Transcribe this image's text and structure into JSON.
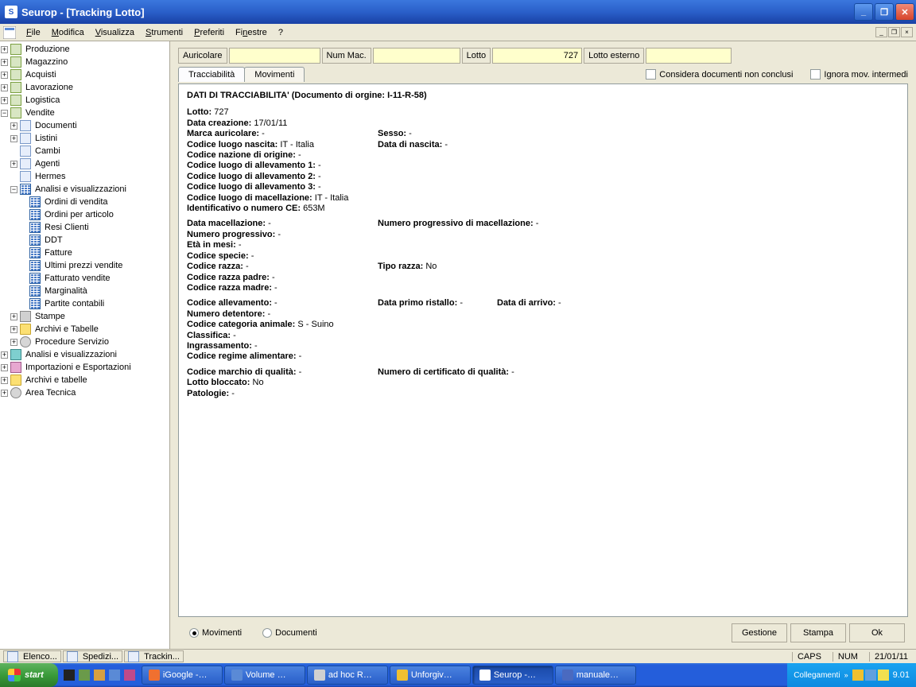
{
  "window": {
    "title": "Seurop - [Tracking Lotto]"
  },
  "menu": {
    "file": "File",
    "modifica": "Modifica",
    "visualizza": "Visualizza",
    "strumenti": "Strumenti",
    "preferiti": "Preferiti",
    "finestre": "Finestre",
    "help": "?"
  },
  "tree": {
    "produzione": "Produzione",
    "magazzino": "Magazzino",
    "acquisti": "Acquisti",
    "lavorazione": "Lavorazione",
    "logistica": "Logistica",
    "vendite": "Vendite",
    "documenti": "Documenti",
    "listini": "Listini",
    "cambi": "Cambi",
    "agenti": "Agenti",
    "hermes": "Hermes",
    "analisi": "Analisi e visualizzazioni",
    "ordini_vendita": "Ordini di vendita",
    "ordini_articolo": "Ordini per articolo",
    "resi": "Resi Clienti",
    "ddt": "DDT",
    "fatture": "Fatture",
    "ultimi_prezzi": "Ultimi prezzi vendite",
    "fatturato": "Fatturato vendite",
    "marginalita": "Marginalità",
    "partite": "Partite contabili",
    "stampe": "Stampe",
    "archivi_tab": "Archivi e Tabelle",
    "procedure": "Procedure Servizio",
    "analisi2": "Analisi e visualizzazioni",
    "import_export": "Importazioni e Esportazioni",
    "archivi_tab2": "Archivi e tabelle",
    "area_tecnica": "Area Tecnica"
  },
  "filters": {
    "auricolare_label": "Auricolare",
    "auricolare_val": "",
    "nummac_label": "Num Mac.",
    "nummac_val": "",
    "lotto_label": "Lotto",
    "lotto_val": "727",
    "lottoest_label": "Lotto esterno",
    "lottoest_val": ""
  },
  "tabs": {
    "tracciabilita": "Tracciabilità",
    "movimenti": "Movimenti"
  },
  "options": {
    "considera": "Considera documenti non conclusi",
    "ignora": "Ignora mov. intermedi"
  },
  "doc": {
    "header": "DATI DI TRACCIABILITA' (Documento di orgine: I-11-R-58)",
    "lotto_l": "Lotto:",
    "lotto_v": "727",
    "data_creaz_l": "Data creazione:",
    "data_creaz_v": "17/01/11",
    "marca_l": "Marca auricolare:",
    "marca_v": "-",
    "sesso_l": "Sesso:",
    "sesso_v": "-",
    "luogo_nasc_l": "Codice luogo nascita:",
    "luogo_nasc_v": "IT - Italia",
    "data_nasc_l": "Data di nascita:",
    "data_nasc_v": "-",
    "naz_orig_l": "Codice nazione di origine:",
    "naz_orig_v": "-",
    "allev1_l": "Codice luogo di allevamento 1:",
    "allev1_v": "-",
    "allev2_l": "Codice luogo di allevamento 2:",
    "allev2_v": "-",
    "allev3_l": "Codice luogo di allevamento 3:",
    "allev3_v": "-",
    "macell_l": "Codice luogo di macellazione:",
    "macell_v": "IT - Italia",
    "ident_l": "Identificativo o numero CE:",
    "ident_v": "653M",
    "data_mac_l": "Data macellazione:",
    "data_mac_v": "-",
    "num_prog_mac_l": "Numero progressivo di macellazione:",
    "num_prog_mac_v": "-",
    "num_prog_l": "Numero progressivo:",
    "num_prog_v": "-",
    "eta_l": "Età in mesi:",
    "eta_v": "-",
    "specie_l": "Codice specie:",
    "specie_v": "-",
    "razza_l": "Codice razza:",
    "razza_v": "-",
    "tipo_razza_l": "Tipo razza:",
    "tipo_razza_v": "No",
    "razza_padre_l": "Codice razza padre:",
    "razza_padre_v": "-",
    "razza_madre_l": "Codice razza madre:",
    "razza_madre_v": "-",
    "cod_allev_l": "Codice allevamento:",
    "cod_allev_v": "-",
    "primo_rist_l": "Data primo ristallo:",
    "primo_rist_v": "-",
    "data_arrivo_l": "Data di arrivo:",
    "data_arrivo_v": "-",
    "num_det_l": "Numero detentore:",
    "num_det_v": "-",
    "cat_anim_l": "Codice categoria animale:",
    "cat_anim_v": "S - Suino",
    "classifica_l": "Classifica:",
    "classifica_v": "-",
    "ingrass_l": "Ingrassamento:",
    "ingrass_v": "-",
    "regime_l": "Codice regime alimentare:",
    "regime_v": "-",
    "marchio_l": "Codice marchio di qualità:",
    "marchio_v": "-",
    "cert_l": "Numero di certificato di qualità:",
    "cert_v": "-",
    "bloccato_l": "Lotto bloccato:",
    "bloccato_v": "No",
    "patologie_l": "Patologie:",
    "patologie_v": "-"
  },
  "footer": {
    "movimenti": "Movimenti",
    "documenti": "Documenti",
    "gestione": "Gestione",
    "stampa": "Stampa",
    "ok": "Ok"
  },
  "mdi_tabs": {
    "elenco": "Elenco...",
    "spedizi": "Spedizi...",
    "tracking": "Trackin..."
  },
  "status": {
    "caps": "CAPS",
    "num": "NUM",
    "date": "21/01/11"
  },
  "taskbar": {
    "start": "start",
    "igoogle": "iGoogle -…",
    "volume": "Volume …",
    "adhoc": "ad hoc R…",
    "unforgiv": "Unforgiv…",
    "seurop": "Seurop -…",
    "manuale": "manuale…",
    "collegamenti": "Collegamenti",
    "clock": "9.01"
  }
}
